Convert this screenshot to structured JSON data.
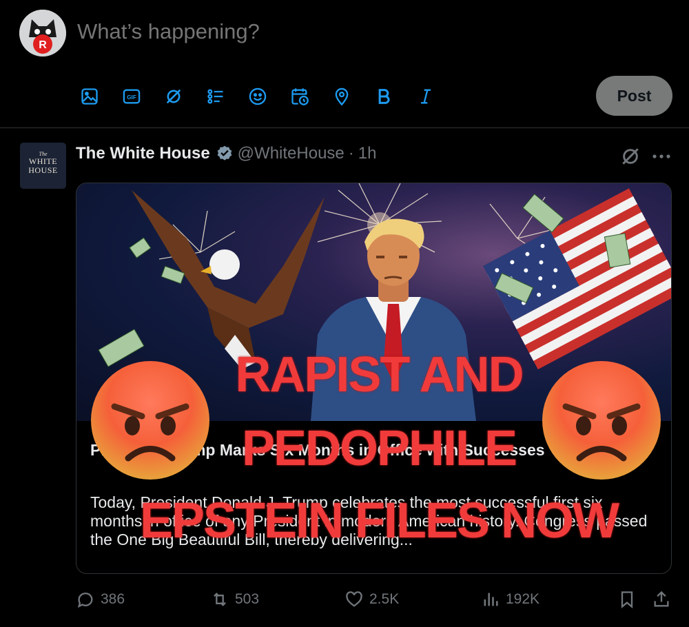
{
  "composer": {
    "placeholder": "What’s happening?",
    "post_label": "Post",
    "tools": [
      "image-icon",
      "gif-icon",
      "grok-icon",
      "poll-icon",
      "emoji-icon",
      "schedule-icon",
      "location-icon",
      "bold-icon",
      "italic-icon"
    ]
  },
  "tweet": {
    "author_name": "The White House",
    "handle": "@WhiteHouse",
    "separator": "·",
    "time": "1h",
    "avatar": {
      "the": "The",
      "line1": "WHITE",
      "line2": "HOUSE"
    },
    "card": {
      "title": "President Trump Marks Six Months in Office with Successes",
      "body": "Today, President Donald J. Trump celebrates the most successful first six months in office of any President in modern American history. Congress passed the One Big Beautiful Bill, thereby delivering..."
    },
    "stats": {
      "replies": "386",
      "reposts": "503",
      "likes": "2.5K",
      "views": "192K"
    }
  },
  "overlay": {
    "line1": "RAPIST AND",
    "line2": "PEDOPHILE",
    "line3": "EPSTEIN FILES NOW",
    "emoji": "😡"
  },
  "colors": {
    "accent": "#1d9bf0",
    "overlay_red": "#f13b3b",
    "muted": "#71767b",
    "post_button": "#787a7a"
  }
}
